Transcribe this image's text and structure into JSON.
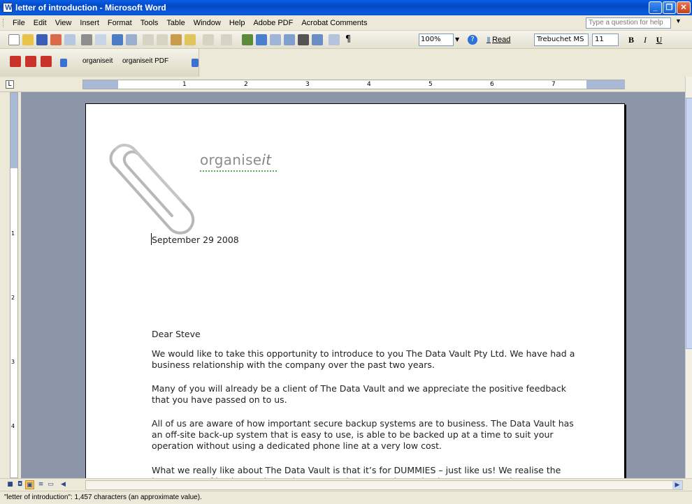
{
  "window": {
    "title": "letter of introduction - Microsoft Word"
  },
  "menu": {
    "items": [
      "File",
      "Edit",
      "View",
      "Insert",
      "Format",
      "Tools",
      "Table",
      "Window",
      "Help",
      "Adobe PDF",
      "Acrobat Comments"
    ],
    "help_placeholder": "Type a question for help"
  },
  "toolbar": {
    "zoom": "100%",
    "read_label": "Read",
    "font": "Trebuchet MS",
    "size": "11",
    "bold": "B",
    "italic": "I",
    "underline": "U"
  },
  "pdf_toolbar": {
    "item1": "organiseit",
    "item2": "organiseit PDF"
  },
  "ruler": {
    "numbers": [
      "1",
      "2",
      "3",
      "4",
      "5",
      "6",
      "7"
    ]
  },
  "vruler": {
    "numbers": [
      "1",
      "2",
      "3",
      "4"
    ]
  },
  "document": {
    "logo_main": "organise",
    "logo_italic": "it",
    "date": "September 29 2008",
    "salutation": "Dear Steve",
    "paragraphs": [
      "We would like to take this opportunity to introduce to you The Data Vault Pty Ltd.  We have had a business relationship with the company over the past two years.",
      "Many of you will already be a client of The Data Vault and we appreciate the positive feedback that you have passed on to us.",
      "All of us are aware of how important secure backup systems are to business.  The Data Vault has an off-site back-up system that is easy to use, is able to be backed up at a time to suit your operation without using a dedicated phone line at a very low cost.",
      "What we really like about The Data Vault is that it’s for DUMMIES – just like us!  We realise the importance of backup and use The Data Vault as our primary backup system.  We have no"
    ]
  },
  "status": {
    "text": "\"letter of introduction\": 1,457 characters (an approximate value)."
  }
}
